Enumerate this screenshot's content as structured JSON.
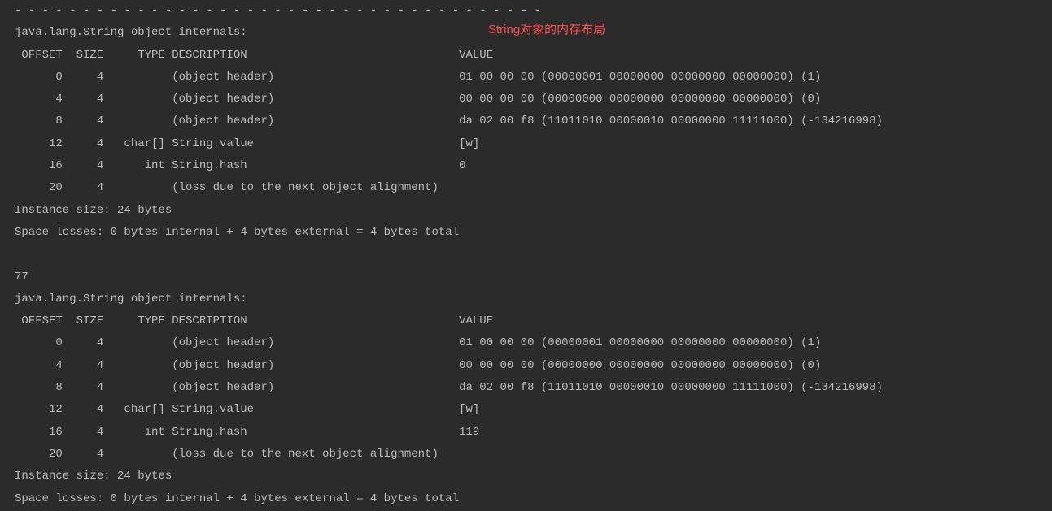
{
  "annotation": "String对象的内存布局",
  "divider": "- - - - - - - - - - - - - - - - - - - - - - - - - - - - - - - - - - - - - - -",
  "block1": {
    "title": "java.lang.String object internals:",
    "header": " OFFSET  SIZE     TYPE DESCRIPTION                               VALUE",
    "rows": [
      "      0     4          (object header)                           01 00 00 00 (00000001 00000000 00000000 00000000) (1)",
      "      4     4          (object header)                           00 00 00 00 (00000000 00000000 00000000 00000000) (0)",
      "      8     4          (object header)                           da 02 00 f8 (11011010 00000010 00000000 11111000) (-134216998)",
      "     12     4   char[] String.value                              [w]",
      "     16     4      int String.hash                               0",
      "     20     4          (loss due to the next object alignment)"
    ],
    "instance_size": "Instance size: 24 bytes",
    "space_losses": "Space losses: 0 bytes internal + 4 bytes external = 4 bytes total"
  },
  "separator_value": "77",
  "block2": {
    "title": "java.lang.String object internals:",
    "header": " OFFSET  SIZE     TYPE DESCRIPTION                               VALUE",
    "rows": [
      "      0     4          (object header)                           01 00 00 00 (00000001 00000000 00000000 00000000) (1)",
      "      4     4          (object header)                           00 00 00 00 (00000000 00000000 00000000 00000000) (0)",
      "      8     4          (object header)                           da 02 00 f8 (11011010 00000010 00000000 11111000) (-134216998)",
      "     12     4   char[] String.value                              [w]",
      "     16     4      int String.hash                               119",
      "     20     4          (loss due to the next object alignment)"
    ],
    "instance_size": "Instance size: 24 bytes",
    "space_losses": "Space losses: 0 bytes internal + 4 bytes external = 4 bytes total"
  }
}
